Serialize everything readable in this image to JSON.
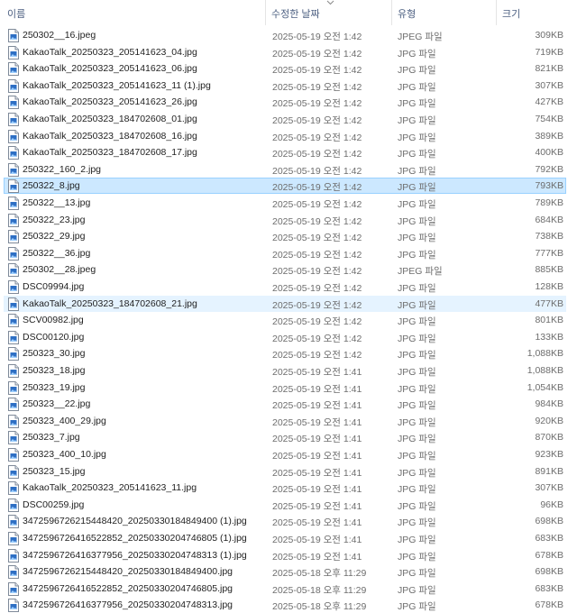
{
  "header": {
    "name": "이름",
    "date": "수정한 날짜",
    "type": "유형",
    "size": "크기"
  },
  "icons": {
    "file": "image-file-icon",
    "sort": "sort-descending-icon"
  },
  "selected_index": 9,
  "hover_index": 16,
  "rows": [
    {
      "name": "250302__16.jpeg",
      "date": "2025-05-19 오전 1:42",
      "type": "JPEG 파일",
      "size": "309KB"
    },
    {
      "name": "KakaoTalk_20250323_205141623_04.jpg",
      "date": "2025-05-19 오전 1:42",
      "type": "JPG 파일",
      "size": "719KB"
    },
    {
      "name": "KakaoTalk_20250323_205141623_06.jpg",
      "date": "2025-05-19 오전 1:42",
      "type": "JPG 파일",
      "size": "821KB"
    },
    {
      "name": "KakaoTalk_20250323_205141623_11 (1).jpg",
      "date": "2025-05-19 오전 1:42",
      "type": "JPG 파일",
      "size": "307KB"
    },
    {
      "name": "KakaoTalk_20250323_205141623_26.jpg",
      "date": "2025-05-19 오전 1:42",
      "type": "JPG 파일",
      "size": "427KB"
    },
    {
      "name": "KakaoTalk_20250323_184702608_01.jpg",
      "date": "2025-05-19 오전 1:42",
      "type": "JPG 파일",
      "size": "754KB"
    },
    {
      "name": "KakaoTalk_20250323_184702608_16.jpg",
      "date": "2025-05-19 오전 1:42",
      "type": "JPG 파일",
      "size": "389KB"
    },
    {
      "name": "KakaoTalk_20250323_184702608_17.jpg",
      "date": "2025-05-19 오전 1:42",
      "type": "JPG 파일",
      "size": "400KB"
    },
    {
      "name": "250322_160_2.jpg",
      "date": "2025-05-19 오전 1:42",
      "type": "JPG 파일",
      "size": "792KB"
    },
    {
      "name": "250322_8.jpg",
      "date": "2025-05-19 오전 1:42",
      "type": "JPG 파일",
      "size": "793KB"
    },
    {
      "name": "250322__13.jpg",
      "date": "2025-05-19 오전 1:42",
      "type": "JPG 파일",
      "size": "789KB"
    },
    {
      "name": "250322_23.jpg",
      "date": "2025-05-19 오전 1:42",
      "type": "JPG 파일",
      "size": "684KB"
    },
    {
      "name": "250322_29.jpg",
      "date": "2025-05-19 오전 1:42",
      "type": "JPG 파일",
      "size": "738KB"
    },
    {
      "name": "250322__36.jpg",
      "date": "2025-05-19 오전 1:42",
      "type": "JPG 파일",
      "size": "777KB"
    },
    {
      "name": "250302__28.jpeg",
      "date": "2025-05-19 오전 1:42",
      "type": "JPEG 파일",
      "size": "885KB"
    },
    {
      "name": "DSC09994.jpg",
      "date": "2025-05-19 오전 1:42",
      "type": "JPG 파일",
      "size": "128KB"
    },
    {
      "name": "KakaoTalk_20250323_184702608_21.jpg",
      "date": "2025-05-19 오전 1:42",
      "type": "JPG 파일",
      "size": "477KB"
    },
    {
      "name": "SCV00982.jpg",
      "date": "2025-05-19 오전 1:42",
      "type": "JPG 파일",
      "size": "801KB"
    },
    {
      "name": "DSC00120.jpg",
      "date": "2025-05-19 오전 1:42",
      "type": "JPG 파일",
      "size": "133KB"
    },
    {
      "name": "250323_30.jpg",
      "date": "2025-05-19 오전 1:42",
      "type": "JPG 파일",
      "size": "1,088KB"
    },
    {
      "name": "250323_18.jpg",
      "date": "2025-05-19 오전 1:41",
      "type": "JPG 파일",
      "size": "1,088KB"
    },
    {
      "name": "250323_19.jpg",
      "date": "2025-05-19 오전 1:41",
      "type": "JPG 파일",
      "size": "1,054KB"
    },
    {
      "name": "250323__22.jpg",
      "date": "2025-05-19 오전 1:41",
      "type": "JPG 파일",
      "size": "984KB"
    },
    {
      "name": "250323_400_29.jpg",
      "date": "2025-05-19 오전 1:41",
      "type": "JPG 파일",
      "size": "920KB"
    },
    {
      "name": "250323_7.jpg",
      "date": "2025-05-19 오전 1:41",
      "type": "JPG 파일",
      "size": "870KB"
    },
    {
      "name": "250323_400_10.jpg",
      "date": "2025-05-19 오전 1:41",
      "type": "JPG 파일",
      "size": "923KB"
    },
    {
      "name": "250323_15.jpg",
      "date": "2025-05-19 오전 1:41",
      "type": "JPG 파일",
      "size": "891KB"
    },
    {
      "name": "KakaoTalk_20250323_205141623_11.jpg",
      "date": "2025-05-19 오전 1:41",
      "type": "JPG 파일",
      "size": "307KB"
    },
    {
      "name": "DSC00259.jpg",
      "date": "2025-05-19 오전 1:41",
      "type": "JPG 파일",
      "size": "96KB"
    },
    {
      "name": "347259672621544842​0_20250330184849400 (1).jpg",
      "date": "2025-05-19 오전 1:41",
      "type": "JPG 파일",
      "size": "698KB"
    },
    {
      "name": "3472596726416522852_20250330204746805 (1).jpg",
      "date": "2025-05-19 오전 1:41",
      "type": "JPG 파일",
      "size": "683KB"
    },
    {
      "name": "3472596726416377956_20250330204748313 (1).jpg",
      "date": "2025-05-19 오전 1:41",
      "type": "JPG 파일",
      "size": "678KB"
    },
    {
      "name": "3472596726215448420_20250330184849400.jpg",
      "date": "2025-05-18 오후 11:29",
      "type": "JPG 파일",
      "size": "698KB"
    },
    {
      "name": "3472596726416522852_20250330204746805.jpg",
      "date": "2025-05-18 오후 11:29",
      "type": "JPG 파일",
      "size": "683KB"
    },
    {
      "name": "3472596726416377956_20250330204748313.jpg",
      "date": "2025-05-18 오후 11:29",
      "type": "JPG 파일",
      "size": "678KB"
    }
  ]
}
